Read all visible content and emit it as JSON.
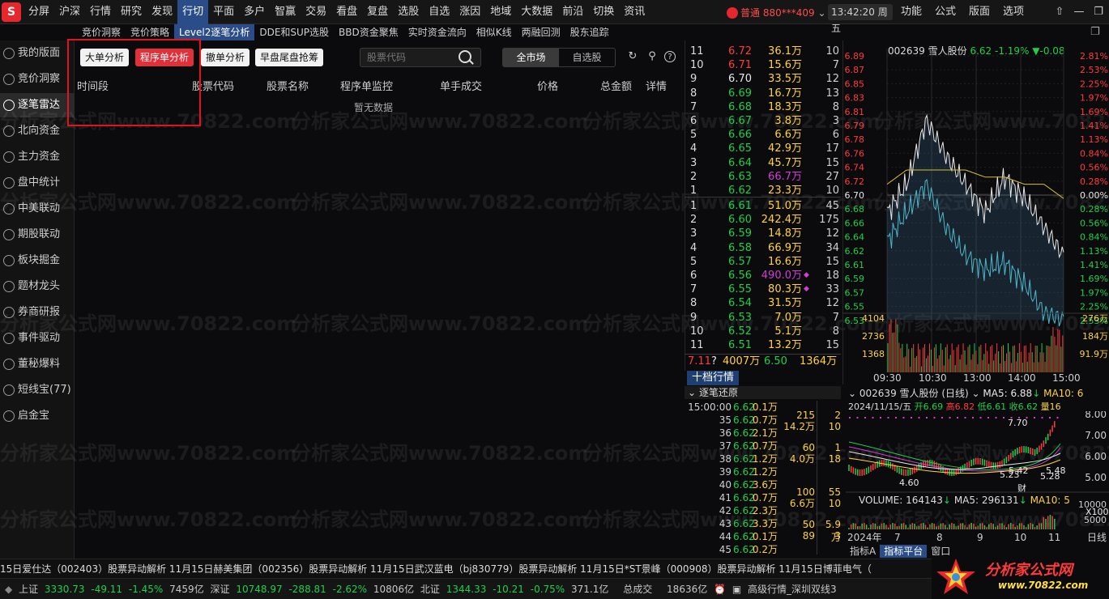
{
  "app": {
    "logo_text": "S",
    "top_menu": [
      "分屏",
      "沪深",
      "行情",
      "研究",
      "发现",
      "行切",
      "平面",
      "多户",
      "智赢",
      "交易",
      "看盘",
      "复盘",
      "选股",
      "自选",
      "涨因",
      "地域",
      "大数据",
      "前沿",
      "切换",
      "资讯"
    ],
    "top_menu_active": 5,
    "account_label": "普通",
    "account_id": "880***409",
    "clock": "13:42:20 周五",
    "right_menu": [
      "功能",
      "公式",
      "版面",
      "选项"
    ]
  },
  "sub_tabs": [
    "竞价洞察",
    "竞价策略",
    "Level2逐笔分析",
    "DDE和SUP选股",
    "BBD资金聚焦",
    "实时资金流向",
    "相似K线",
    "两融回测",
    "股东追踪"
  ],
  "sub_tab_active": 2,
  "sidebar": [
    {
      "label": "我的版面"
    },
    {
      "label": "竞价洞察"
    },
    {
      "label": "逐笔雷达"
    },
    {
      "label": "北向资金"
    },
    {
      "label": "主力资金"
    },
    {
      "label": "盘中统计"
    },
    {
      "label": "中美联动"
    },
    {
      "label": "期股联动"
    },
    {
      "label": "板块掘金"
    },
    {
      "label": "题材龙头"
    },
    {
      "label": "券商研报"
    },
    {
      "label": "事件驱动"
    },
    {
      "label": "董秘爆料"
    },
    {
      "label": "短线宝(77)"
    },
    {
      "label": "启金宝"
    }
  ],
  "sidebar_active": 2,
  "panel": {
    "buttons": [
      "大单分析",
      "程序单分析",
      "撤单分析",
      "早盘尾盘抢筹"
    ],
    "active_button": 1,
    "search_placeholder": "股票代码",
    "scope": [
      "全市场",
      "自选股"
    ],
    "scope_active": 0,
    "columns": [
      "时间段",
      "股票代码",
      "股票名称",
      "程序单监控",
      "单手成交",
      "价格",
      "总金额",
      "详情"
    ],
    "empty_text": "暂无数据"
  },
  "watermark": "分析家公式网www.70822.com",
  "order_book": {
    "asks": [
      {
        "lv": "11",
        "price": "6.72",
        "vol": "36.1万",
        "count": "10",
        "color": "up"
      },
      {
        "lv": "10",
        "price": "6.71",
        "vol": "15.6万",
        "count": "7",
        "color": "up"
      },
      {
        "lv": "9",
        "price": "6.70",
        "vol": "33.5万",
        "count": "12",
        "color": "white"
      },
      {
        "lv": "8",
        "price": "6.69",
        "vol": "16.7万",
        "count": "13",
        "color": "down"
      },
      {
        "lv": "7",
        "price": "6.68",
        "vol": "18.3万",
        "count": "8",
        "color": "down"
      },
      {
        "lv": "6",
        "price": "6.67",
        "vol": "3.8万",
        "count": "3",
        "color": "down"
      },
      {
        "lv": "5",
        "price": "6.66",
        "vol": "6.6万",
        "count": "6",
        "color": "down"
      },
      {
        "lv": "4",
        "price": "6.65",
        "vol": "42.9万",
        "count": "17",
        "color": "down"
      },
      {
        "lv": "3",
        "price": "6.64",
        "vol": "45.7万",
        "count": "15",
        "color": "down"
      },
      {
        "lv": "2",
        "price": "6.63",
        "vol": "66.7万",
        "count": "27",
        "color": "down",
        "purple": true
      },
      {
        "lv": "1",
        "price": "6.62",
        "vol": "23.3万",
        "count": "10",
        "color": "down"
      }
    ],
    "bids": [
      {
        "lv": "1",
        "price": "6.61",
        "vol": "51.0万",
        "count": "45",
        "color": "down"
      },
      {
        "lv": "2",
        "price": "6.60",
        "vol": "242.4万",
        "count": "175",
        "color": "down"
      },
      {
        "lv": "3",
        "price": "6.59",
        "vol": "14.8万",
        "count": "12",
        "color": "down"
      },
      {
        "lv": "4",
        "price": "6.58",
        "vol": "66.9万",
        "count": "34",
        "color": "down"
      },
      {
        "lv": "5",
        "price": "6.57",
        "vol": "16.6万",
        "count": "15",
        "color": "down"
      },
      {
        "lv": "6",
        "price": "6.56",
        "vol": "490.0万",
        "count": "18",
        "color": "down",
        "purple": true,
        "mark": "◆"
      },
      {
        "lv": "7",
        "price": "6.55",
        "vol": "80.3万",
        "count": "33",
        "color": "down",
        "mark": "◆"
      },
      {
        "lv": "8",
        "price": "6.54",
        "vol": "31.5万",
        "count": "12",
        "color": "down"
      },
      {
        "lv": "9",
        "price": "6.53",
        "vol": "7.0万",
        "count": "7",
        "color": "down"
      },
      {
        "lv": "10",
        "price": "6.52",
        "vol": "5.1万",
        "count": "8",
        "color": "down"
      },
      {
        "lv": "11",
        "price": "6.51",
        "vol": "13.2万",
        "count": "15",
        "color": "down"
      }
    ],
    "footer": {
      "ask_avg": "7.11",
      "q": "?",
      "ask_total": "4007万",
      "bid_avg": "6.50",
      "bid_total": "1364万"
    }
  },
  "ten_level_tab": "十档行情",
  "tick_header": "逐笔还原",
  "ticks": [
    {
      "t": "15:00:00",
      "p": "6.62",
      "v": "0.1万"
    },
    {
      "t": "35",
      "p": "6.62",
      "v": "0.7万"
    },
    {
      "t": "36",
      "p": "6.62",
      "v": "2.1万"
    },
    {
      "t": "37",
      "p": "6.62",
      "v": "0.7万"
    },
    {
      "t": "38",
      "p": "6.62",
      "v": "1.2万"
    },
    {
      "t": "39",
      "p": "6.62",
      "v": "1.2万"
    },
    {
      "t": "40",
      "p": "6.62",
      "v": "3.6万"
    },
    {
      "t": "41",
      "p": "6.62",
      "v": "0.7万"
    },
    {
      "t": "42",
      "p": "6.62",
      "v": "2.3万"
    },
    {
      "t": "43",
      "p": "6.62",
      "v": "3.3万"
    },
    {
      "t": "44",
      "p": "6.62",
      "v": "0.1万"
    },
    {
      "t": "45",
      "p": "6.62",
      "v": "0.2万"
    }
  ],
  "tick_mid": [
    {
      "a": "215",
      "b": "14.2万",
      "c": "2",
      "d": "10"
    },
    {
      "a": "60",
      "b": "4.0万",
      "c": "1",
      "d": "18"
    },
    {
      "a": "100",
      "b": "6.6万",
      "c": "55",
      "d": "10"
    },
    {
      "a": "50",
      "b": "89",
      "c": "5.9万",
      "d": "3"
    }
  ],
  "intraday": {
    "header": "002639 雪人股份",
    "last": "6.62",
    "chg": "-1.19%",
    "delta": "▼-0.08",
    "price_labels": [
      "6.89",
      "6.87",
      "6.85",
      "6.83",
      "6.81",
      "6.79",
      "6.78",
      "6.76",
      "6.74",
      "6.72",
      "6.70",
      "6.68",
      "6.66",
      "6.64",
      "6.62",
      "6.61",
      "6.59",
      "6.57",
      "6.55",
      "6.53"
    ],
    "pct_labels": [
      "2.81%",
      "2.53%",
      "2.25%",
      "1.97%",
      "1.69%",
      "1.41%",
      "1.13%",
      "0.84%",
      "0.56%",
      "0.28%",
      "0.00%",
      "0.28%",
      "0.56%",
      "0.84%",
      "1.13%",
      "1.41%",
      "1.69%",
      "1.97%",
      "2.25%",
      "2.53%"
    ],
    "vol_labels": [
      "4104",
      "2736",
      "1368"
    ],
    "vol_right": [
      "276万",
      "184万",
      "91.9万"
    ],
    "time_labels": [
      "09:30",
      "10:30",
      "13:00",
      "14:00",
      "15:00"
    ]
  },
  "chart_data": {
    "type": "line",
    "x": [
      "09:30",
      "10:30",
      "13:00",
      "14:00",
      "15:00"
    ],
    "series": [
      {
        "name": "price",
        "values": [
          6.68,
          6.72,
          6.81,
          6.76,
          6.72,
          6.68,
          6.73,
          6.7,
          6.66,
          6.62
        ]
      },
      {
        "name": "avg",
        "values": [
          6.72,
          6.74,
          6.74,
          6.74,
          6.74,
          6.73,
          6.73,
          6.72,
          6.72,
          6.7
        ]
      }
    ],
    "ylim": [
      6.52,
      6.9
    ]
  },
  "daily": {
    "header": "002639 雪人股份 (日线)",
    "ma5": "MA5: 6.88",
    "ma10": "MA10: 6",
    "date": "2024/11/15/五",
    "open": "开6.69",
    "high": "高6.82",
    "low": "低6.61",
    "close": "收6.62",
    "vol": "量16",
    "y_labels": [
      "8.00",
      "7.00",
      "6.00",
      "5.00"
    ],
    "annotations": [
      "7.70",
      "4.60",
      "5.23",
      "5.42",
      "5.48",
      "5.28",
      "财"
    ],
    "vol_header": "VOLUME: 164143",
    "vol_ma5": "MA5: 296131",
    "vol_ma10": "MA10: 5",
    "vol_unit": "X100",
    "vol_y": [
      "10000",
      "5000"
    ],
    "x_labels": [
      "2024年",
      "7",
      "8",
      "9",
      "10",
      "11"
    ],
    "period": "日线",
    "tabs": [
      "指标A",
      "指标平台",
      "窗口"
    ]
  },
  "ticker": "15日爱仕达（002403）股票异动解析    11月15日赫美集团（002356）股票异动解析    11月15日武汉蓝电（bj830779）股票异动解析    11月15日*ST景峰（000908）股票异动解析    11月15日博菲电气（",
  "status": {
    "sh_label": "上证",
    "sh": "3330.73",
    "sh_chg": "-49.11",
    "sh_pct": "-1.45%",
    "sh_amt": "7459亿",
    "sz_label": "深证",
    "sz": "10748.97",
    "sz_chg": "-288.81",
    "sz_pct": "-2.62%",
    "sz_amt": "10806亿",
    "bz_label": "北证",
    "bz": "1344.33",
    "bz_chg": "-10.21",
    "bz_pct": "-0.75%",
    "bz_amt": "371.1亿",
    "total_label": "总成交",
    "total": "18636亿",
    "quote": "高级行情_深圳双线3"
  },
  "brand": {
    "name": "分析家公式网",
    "url": "www.70822.com"
  }
}
